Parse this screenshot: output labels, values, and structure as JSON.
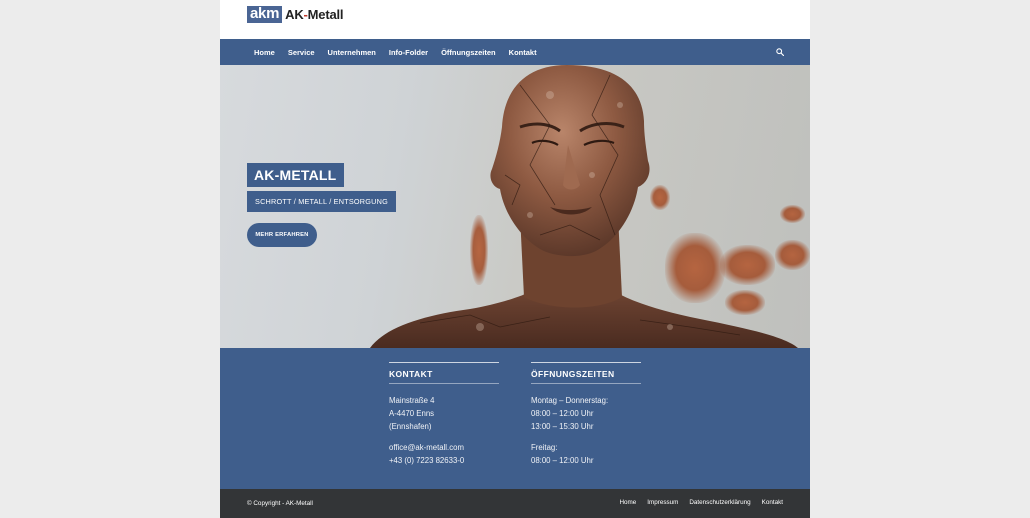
{
  "logo": {
    "mark": "akm",
    "name_part1": "AK",
    "name_dash": "-",
    "name_part2": "Metall"
  },
  "nav": {
    "items": [
      "Home",
      "Service",
      "Unternehmen",
      "Info-Folder",
      "Öffnungszeiten",
      "Kontakt"
    ],
    "search_icon": "search-icon"
  },
  "hero": {
    "title": "AK-METALL",
    "subtitle": "SCHROTT / METALL / ENTSORGUNG",
    "button": "MEHR ERFAHREN"
  },
  "contact": {
    "heading": "KONTAKT",
    "street": "Mainstraße 4",
    "city": "A-4470 Enns",
    "region": "(Ennshafen)",
    "email": "office@ak-metall.com",
    "phone": "+43 (0) 7223 82633-0"
  },
  "hours": {
    "heading": "ÖFFNUNGSZEITEN",
    "weekday_label": "Montag – Donnerstag:",
    "weekday_am": "08:00 – 12:00 Uhr",
    "weekday_pm": "13:00 – 15:30 Uhr",
    "friday_label": "Freitag:",
    "friday_am": "08:00 – 12:00 Uhr"
  },
  "footer": {
    "copyright": "© Copyright - AK-Metall",
    "links": [
      "Home",
      "Impressum",
      "Datenschutzerklärung",
      "Kontakt"
    ]
  },
  "colors": {
    "brand_blue": "#3f5e8c",
    "footer_dark": "#333537",
    "accent_red": "#c0392b"
  }
}
